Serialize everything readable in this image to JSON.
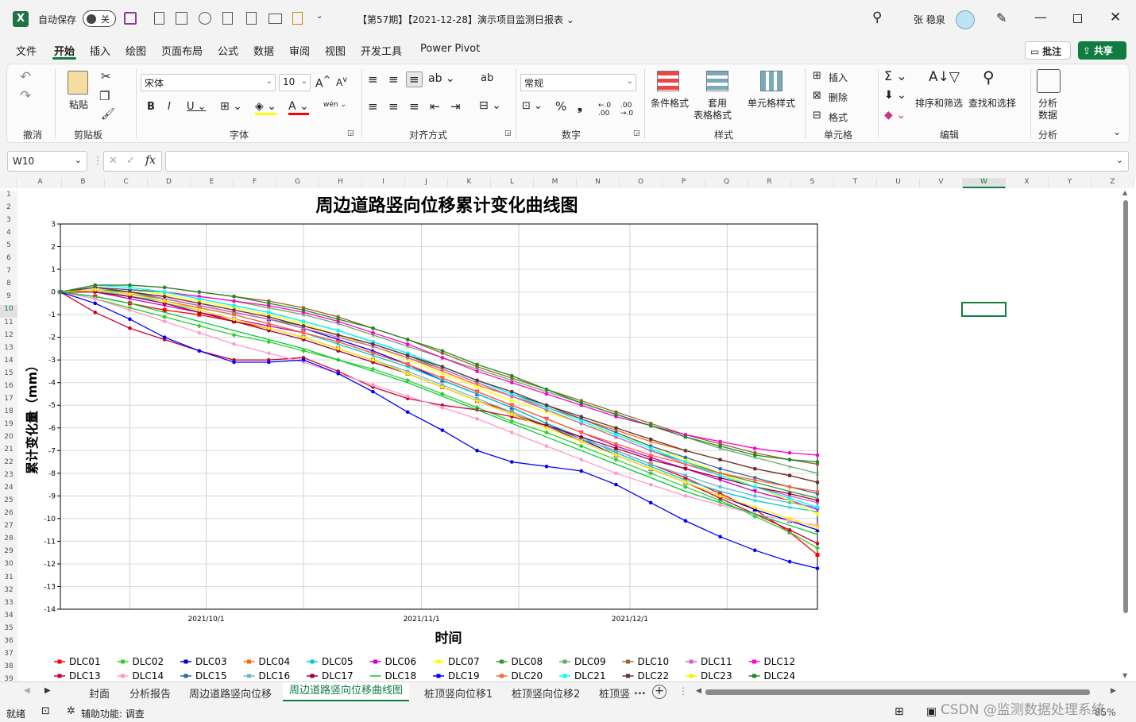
{
  "titlebar": {
    "autosave_label": "自动保存",
    "autosave_state": "关",
    "doc_title": "【第57期】【2021-12-28】演示项目监测日报表 ⌄",
    "user_name": "张 稳泉"
  },
  "menu": [
    "文件",
    "开始",
    "插入",
    "绘图",
    "页面布局",
    "公式",
    "数据",
    "审阅",
    "视图",
    "开发工具",
    "Power Pivot"
  ],
  "menu_active": "开始",
  "comments_label": "批注",
  "share_label": "共享",
  "ribbon": {
    "undo_group": "撤消",
    "clipboard_group": "剪贴板",
    "paste_label": "粘贴",
    "font_group": "字体",
    "font_name": "宋体",
    "font_size": "10",
    "align_group": "对齐方式",
    "number_group": "数字",
    "number_format": "常规",
    "styles_group": "样式",
    "cond_format": "条件格式",
    "table_format_1": "套用",
    "table_format_2": "表格格式",
    "cell_style": "单元格样式",
    "cells_group": "单元格",
    "insert": "插入",
    "delete": "删除",
    "format": "格式",
    "edit_group": "编辑",
    "sort_filter": "排序和筛选",
    "find_select": "查找和选择",
    "analysis_group": "分析",
    "analyze_1": "分析",
    "analyze_2": "数据"
  },
  "formula": {
    "name_box": "W10",
    "fx": "fx",
    "content": ""
  },
  "columns": [
    "A",
    "B",
    "C",
    "D",
    "E",
    "F",
    "G",
    "H",
    "I",
    "J",
    "K",
    "L",
    "M",
    "N",
    "O",
    "P",
    "Q",
    "R",
    "S",
    "T",
    "U",
    "V",
    "W",
    "X",
    "Y",
    "Z"
  ],
  "rows": [
    "1",
    "2",
    "3",
    "4",
    "5",
    "6",
    "7",
    "8",
    "9",
    "10",
    "11",
    "12",
    "13",
    "14",
    "15",
    "16",
    "17",
    "18",
    "19",
    "20",
    "21",
    "22",
    "23",
    "24",
    "25",
    "26",
    "27",
    "28",
    "29",
    "30",
    "31",
    "32",
    "33",
    "34",
    "35",
    "36",
    "37",
    "38",
    "39"
  ],
  "selected_cell": "W10",
  "tabs": [
    "封面",
    "分析报告",
    "周边道路竖向位移",
    "周边道路竖向位移曲线图",
    "桩顶竖向位移1",
    "桩顶竖向位移2",
    "桩顶竖"
  ],
  "active_tab": "周边道路竖向位移曲线图",
  "tab_overflow": "...",
  "status": {
    "ready": "就绪",
    "accessibility": "辅助功能: 调查",
    "zoom": "85%",
    "watermark": "CSDN @监测数据处理系统"
  },
  "colors": {
    "accent": "#107c41",
    "excel_green": "#217346"
  },
  "chart_data": {
    "type": "line",
    "title": "周边道路竖向位移累计变化曲线图",
    "xlabel": "时间",
    "ylabel": "累计变化量（mm）",
    "ylim": [
      -14,
      3
    ],
    "yticks": [
      "3",
      "2",
      "1",
      "0",
      "-1",
      "-2",
      "-3",
      "-4",
      "-5",
      "-6",
      "-7",
      "-8",
      "-9",
      "-10",
      "-11",
      "-12",
      "-13",
      "-14"
    ],
    "xlim": [
      "2021-09-10",
      "2021-12-28"
    ],
    "xticks": [
      "2021/10/1",
      "2021/11/1",
      "2021/12/1"
    ],
    "grid": true,
    "legend": "bottom",
    "x": [
      "2021-09-10",
      "2021-09-15",
      "2021-09-20",
      "2021-09-25",
      "2021-09-30",
      "2021-10-05",
      "2021-10-10",
      "2021-10-15",
      "2021-10-20",
      "2021-10-25",
      "2021-10-30",
      "2021-11-04",
      "2021-11-09",
      "2021-11-14",
      "2021-11-19",
      "2021-11-24",
      "2021-11-29",
      "2021-12-04",
      "2021-12-09",
      "2021-12-14",
      "2021-12-19",
      "2021-12-24",
      "2021-12-28"
    ],
    "series": [
      {
        "name": "DLC01",
        "color": "#ff0000",
        "marker": "square",
        "values": [
          0,
          -0.2,
          -0.5,
          -0.8,
          -1.0,
          -1.3,
          -1.6,
          -2.0,
          -2.5,
          -3.0,
          -3.6,
          -4.2,
          -4.8,
          -5.3,
          -5.9,
          -6.5,
          -7.0,
          -7.6,
          -8.2,
          -8.9,
          -9.6,
          -10.6,
          -11.6
        ]
      },
      {
        "name": "DLC02",
        "color": "#33cc33",
        "marker": "diamond",
        "values": [
          0,
          -0.3,
          -0.7,
          -1.1,
          -1.5,
          -1.9,
          -2.2,
          -2.6,
          -3.0,
          -3.4,
          -3.9,
          -4.5,
          -5.1,
          -5.7,
          -6.2,
          -6.8,
          -7.4,
          -8.0,
          -8.6,
          -9.2,
          -9.9,
          -10.6,
          -11.3
        ]
      },
      {
        "name": "DLC03",
        "color": "#0000cc",
        "marker": "triangle",
        "values": [
          0,
          0.1,
          -0.1,
          -0.3,
          -0.6,
          -0.9,
          -1.2,
          -1.6,
          -2.1,
          -2.6,
          -3.2,
          -3.9,
          -4.5,
          -5.1,
          -5.8,
          -6.5,
          -7.2,
          -7.8,
          -8.4,
          -9.0,
          -9.6,
          -10.1,
          -10.5
        ]
      },
      {
        "name": "DLC04",
        "color": "#ff6600",
        "marker": "x",
        "values": [
          0,
          0.2,
          0.0,
          -0.2,
          -0.5,
          -0.8,
          -1.1,
          -1.5,
          -1.9,
          -2.4,
          -2.9,
          -3.5,
          -4.1,
          -4.6,
          -5.1,
          -5.6,
          -6.1,
          -6.6,
          -7.0,
          -7.4,
          -7.8,
          -8.1,
          -8.4
        ]
      },
      {
        "name": "DLC05",
        "color": "#00cccc",
        "marker": "x",
        "values": [
          0,
          0.1,
          -0.2,
          -0.4,
          -0.7,
          -1.0,
          -1.4,
          -1.8,
          -2.3,
          -2.8,
          -3.3,
          -3.9,
          -4.5,
          -5.1,
          -5.8,
          -6.4,
          -7.1,
          -7.7,
          -8.3,
          -8.8,
          -9.2,
          -9.5,
          -9.7
        ]
      },
      {
        "name": "DLC06",
        "color": "#cc00cc",
        "marker": "triangle-down",
        "values": [
          0,
          0.0,
          -0.3,
          -0.6,
          -0.9,
          -1.2,
          -1.5,
          -1.8,
          -2.2,
          -2.7,
          -3.2,
          -3.8,
          -4.4,
          -5.0,
          -5.6,
          -6.2,
          -6.8,
          -7.3,
          -7.8,
          -8.3,
          -8.8,
          -9.2,
          -9.6
        ]
      },
      {
        "name": "DLC07",
        "color": "#ffff00",
        "marker": "circle",
        "values": [
          0,
          0.2,
          0.1,
          -0.1,
          -0.4,
          -0.7,
          -1.0,
          -1.4,
          -1.9,
          -2.4,
          -3.0,
          -3.6,
          -4.2,
          -4.8,
          -5.3,
          -5.8,
          -6.3,
          -6.8,
          -7.4,
          -8.0,
          -8.6,
          -9.2,
          -9.8
        ]
      },
      {
        "name": "DLC08",
        "color": "#339933",
        "marker": "plus",
        "values": [
          0,
          0.1,
          0.0,
          -0.3,
          -0.6,
          -0.9,
          -1.2,
          -1.5,
          -1.9,
          -2.3,
          -2.8,
          -3.4,
          -4.0,
          -4.6,
          -5.2,
          -5.8,
          -6.4,
          -7.0,
          -7.5,
          -8.0,
          -8.4,
          -8.8,
          -9.1
        ]
      },
      {
        "name": "DLC09",
        "color": "#66aa66",
        "marker": "x",
        "values": [
          0,
          0.3,
          0.2,
          0.0,
          -0.2,
          -0.4,
          -0.7,
          -1.0,
          -1.4,
          -1.9,
          -2.4,
          -2.9,
          -3.4,
          -3.9,
          -4.4,
          -4.9,
          -5.4,
          -5.9,
          -6.4,
          -6.9,
          -7.3,
          -7.7,
          -8.0
        ]
      },
      {
        "name": "DLC10",
        "color": "#996633",
        "marker": "circle",
        "values": [
          0,
          0.3,
          0.3,
          0.2,
          0.0,
          -0.2,
          -0.4,
          -0.7,
          -1.1,
          -1.6,
          -2.1,
          -2.7,
          -3.3,
          -3.8,
          -4.3,
          -4.8,
          -5.3,
          -5.8,
          -6.3,
          -6.7,
          -7.1,
          -7.4,
          -7.6
        ]
      },
      {
        "name": "DLC11",
        "color": "#cc66cc",
        "marker": "circle",
        "values": [
          0,
          0.1,
          -0.1,
          -0.3,
          -0.6,
          -0.9,
          -1.2,
          -1.6,
          -2.0,
          -2.4,
          -2.9,
          -3.4,
          -4.0,
          -4.6,
          -5.2,
          -5.8,
          -6.4,
          -7.0,
          -7.6,
          -8.1,
          -8.6,
          -9.0,
          -9.3
        ]
      },
      {
        "name": "DLC12",
        "color": "#ff00cc",
        "marker": "circle",
        "values": [
          0,
          0.2,
          0.1,
          0.0,
          -0.2,
          -0.4,
          -0.6,
          -0.9,
          -1.3,
          -1.8,
          -2.3,
          -2.9,
          -3.5,
          -4.0,
          -4.5,
          -5.0,
          -5.5,
          -5.9,
          -6.3,
          -6.6,
          -6.9,
          -7.1,
          -7.2
        ]
      },
      {
        "name": "DLC13",
        "color": "#cc0033",
        "marker": "circle",
        "values": [
          0,
          -0.9,
          -1.6,
          -2.1,
          -2.6,
          -3.0,
          -3.0,
          -2.9,
          -3.5,
          -4.2,
          -4.7,
          -5.0,
          -5.2,
          -5.5,
          -5.9,
          -6.6,
          -7.2,
          -7.8,
          -8.4,
          -9.1,
          -9.8,
          -10.5,
          -11.1
        ]
      },
      {
        "name": "DLC14",
        "color": "#ff99cc",
        "marker": "circle",
        "values": [
          0,
          -0.3,
          -0.8,
          -1.3,
          -1.8,
          -2.3,
          -2.7,
          -3.1,
          -3.6,
          -4.1,
          -4.6,
          -5.1,
          -5.6,
          -6.2,
          -6.8,
          -7.4,
          -8.0,
          -8.5,
          -9.0,
          -9.4,
          -9.8,
          -10.1,
          -10.3
        ]
      },
      {
        "name": "DLC15",
        "color": "#336699",
        "marker": "circle",
        "values": [
          0,
          0.2,
          0.1,
          0.0,
          -0.3,
          -0.6,
          -0.9,
          -1.3,
          -1.7,
          -2.2,
          -2.7,
          -3.3,
          -3.9,
          -4.5,
          -5.0,
          -5.6,
          -6.2,
          -6.8,
          -7.3,
          -7.8,
          -8.2,
          -8.6,
          -8.9
        ]
      },
      {
        "name": "DLC16",
        "color": "#66bbcc",
        "marker": "circle",
        "values": [
          0,
          0.1,
          -0.2,
          -0.5,
          -0.8,
          -1.2,
          -1.6,
          -2.0,
          -2.5,
          -3.0,
          -3.5,
          -4.1,
          -4.7,
          -5.3,
          -5.9,
          -6.5,
          -7.0,
          -7.6,
          -8.1,
          -8.6,
          -9.0,
          -9.3,
          -9.5
        ]
      },
      {
        "name": "DLC17",
        "color": "#990033",
        "marker": "circle",
        "values": [
          0,
          0.0,
          -0.2,
          -0.5,
          -0.9,
          -1.3,
          -1.7,
          -2.1,
          -2.6,
          -3.1,
          -3.6,
          -4.2,
          -4.8,
          -5.4,
          -5.9,
          -6.4,
          -6.9,
          -7.4,
          -7.8,
          -8.2,
          -8.6,
          -8.9,
          -9.2
        ]
      },
      {
        "name": "DLC18",
        "color": "#00cc33",
        "marker": "none",
        "values": [
          0,
          -0.2,
          -0.5,
          -0.9,
          -1.3,
          -1.7,
          -2.1,
          -2.5,
          -3.0,
          -3.5,
          -4.0,
          -4.6,
          -5.2,
          -5.8,
          -6.4,
          -7.0,
          -7.6,
          -8.2,
          -8.8,
          -9.3,
          -9.8,
          -10.3,
          -10.7
        ]
      },
      {
        "name": "DLC19",
        "color": "#0000ff",
        "marker": "circle",
        "values": [
          0,
          -0.5,
          -1.2,
          -2.0,
          -2.6,
          -3.1,
          -3.1,
          -3.0,
          -3.6,
          -4.4,
          -5.3,
          -6.1,
          -7.0,
          -7.5,
          -7.7,
          -7.9,
          -8.5,
          -9.3,
          -10.1,
          -10.8,
          -11.4,
          -11.9,
          -12.2
        ]
      },
      {
        "name": "DLC20",
        "color": "#ff6633",
        "marker": "circle",
        "values": [
          0,
          0.1,
          -0.1,
          -0.4,
          -0.7,
          -1.0,
          -1.4,
          -1.8,
          -2.2,
          -2.7,
          -3.2,
          -3.8,
          -4.4,
          -5.0,
          -5.6,
          -6.2,
          -6.7,
          -7.2,
          -7.6,
          -8.0,
          -8.3,
          -8.6,
          -8.8
        ]
      },
      {
        "name": "DLC21",
        "color": "#00ffff",
        "marker": "circle",
        "values": [
          0,
          0.3,
          0.2,
          0.0,
          -0.3,
          -0.6,
          -0.9,
          -1.3,
          -1.7,
          -2.2,
          -2.7,
          -3.3,
          -3.9,
          -4.5,
          -5.1,
          -5.7,
          -6.3,
          -6.9,
          -7.5,
          -8.1,
          -8.6,
          -9.1,
          -9.5
        ]
      },
      {
        "name": "DLC22",
        "color": "#663333",
        "marker": "circle",
        "values": [
          0,
          0.2,
          0.0,
          -0.2,
          -0.5,
          -0.8,
          -1.1,
          -1.5,
          -1.9,
          -2.3,
          -2.8,
          -3.3,
          -3.9,
          -4.4,
          -5.0,
          -5.5,
          -6.0,
          -6.5,
          -7.0,
          -7.4,
          -7.8,
          -8.1,
          -8.4
        ]
      },
      {
        "name": "DLC23",
        "color": "#ffee00",
        "marker": "circle",
        "values": [
          0,
          0.1,
          -0.1,
          -0.4,
          -0.8,
          -1.2,
          -1.6,
          -2.0,
          -2.5,
          -3.0,
          -3.6,
          -4.2,
          -4.8,
          -5.4,
          -6.0,
          -6.6,
          -7.2,
          -7.8,
          -8.4,
          -9.0,
          -9.5,
          -10.0,
          -10.4
        ]
      },
      {
        "name": "DLC24",
        "color": "#228822",
        "marker": "circle",
        "values": [
          0,
          0.3,
          0.3,
          0.2,
          0.0,
          -0.2,
          -0.5,
          -0.8,
          -1.2,
          -1.6,
          -2.1,
          -2.6,
          -3.2,
          -3.7,
          -4.3,
          -4.9,
          -5.4,
          -5.9,
          -6.4,
          -6.8,
          -7.2,
          -7.4,
          -7.5
        ]
      }
    ]
  }
}
